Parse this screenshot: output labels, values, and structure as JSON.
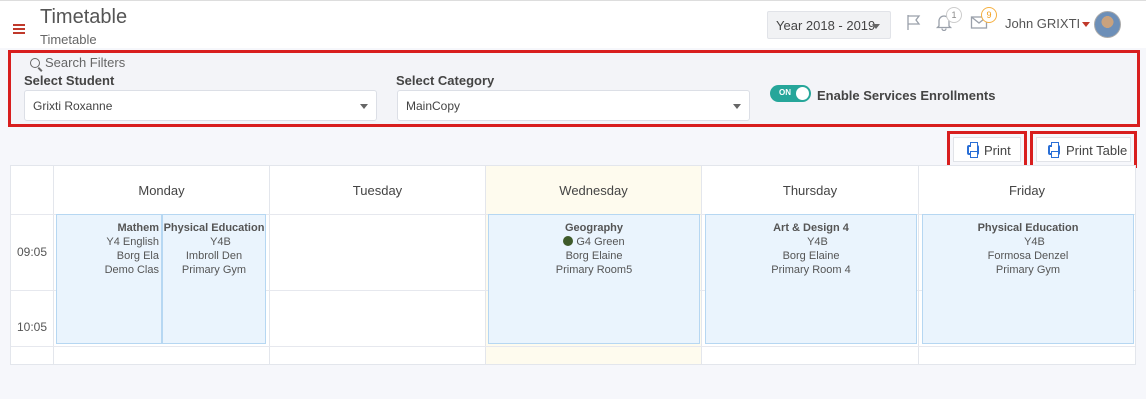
{
  "header": {
    "title": "Timetable",
    "subtitle": "Timetable",
    "year_select": "Year 2018 - 2019",
    "notifications_count": "1",
    "messages_count": "9",
    "user_name": "John GRIXTI"
  },
  "filters": {
    "title": "Search Filters",
    "student_label": "Select Student",
    "student_value": "Grixti Roxanne",
    "category_label": "Select Category",
    "category_value": "MainCopy",
    "toggle_state": "ON",
    "toggle_label": "Enable Services Enrollments"
  },
  "actions": {
    "print": "Print",
    "print_table": "Print Table"
  },
  "timetable": {
    "days": [
      "Monday",
      "Tuesday",
      "Wednesday",
      "Thursday",
      "Friday"
    ],
    "times": [
      "09:05",
      "10:05"
    ],
    "events": [
      {
        "day": "Monday",
        "name": "Mathem",
        "group": "Y4 English",
        "teacher": "Borg Ela",
        "room": "Demo Clas",
        "dot_color": "#ffffff"
      },
      {
        "day": "Monday",
        "name": "Physical Education",
        "group": "Y4B",
        "teacher": "Imbroll Den",
        "room": "Primary Gym",
        "dot_color": "#ffffff"
      },
      {
        "day": "Wednesday",
        "name": "Geography",
        "group": "G4 Green",
        "teacher": "Borg Elaine",
        "room": "Primary Room5",
        "dot_color": "#3e5a2a"
      },
      {
        "day": "Thursday",
        "name": "Art & Design 4",
        "group": "Y4B",
        "teacher": "Borg Elaine",
        "room": "Primary Room 4",
        "dot_color": "#ffffff"
      },
      {
        "day": "Friday",
        "name": "Physical Education",
        "group": "Y4B",
        "teacher": "Formosa Denzel",
        "room": "Primary Gym",
        "dot_color": "#ffffff"
      }
    ]
  },
  "colors": {
    "accent_red": "#d81e1e",
    "event_bg": "#eaf4fd",
    "today_bg": "#fefbee",
    "toggle_green": "#26a69a",
    "print_icon_blue": "#2a6fd6"
  }
}
